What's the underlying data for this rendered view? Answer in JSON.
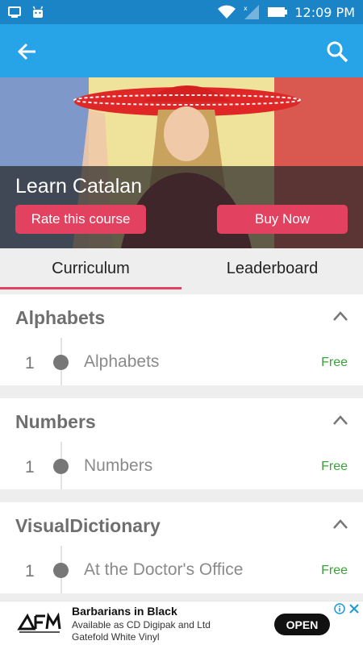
{
  "status_bar": {
    "time": "12:09 PM"
  },
  "app_bar": {
    "back_icon": "arrow-left",
    "search_icon": "search"
  },
  "hero": {
    "title": "Learn Catalan",
    "rate_label": "Rate this course",
    "buy_label": "Buy Now"
  },
  "tabs": [
    {
      "label": "Curriculum",
      "active": true
    },
    {
      "label": "Leaderboard",
      "active": false
    }
  ],
  "sections": [
    {
      "title": "Alphabets",
      "lessons": [
        {
          "num": "1",
          "name": "Alphabets",
          "badge": "Free"
        }
      ]
    },
    {
      "title": "Numbers",
      "lessons": [
        {
          "num": "1",
          "name": "Numbers",
          "badge": "Free"
        }
      ]
    },
    {
      "title": "VisualDictionary",
      "lessons": [
        {
          "num": "1",
          "name": "At the Doctor's Office",
          "badge": "Free"
        }
      ]
    }
  ],
  "ad": {
    "title": "Barbarians in Black",
    "description": "Available as CD Digipak and Ltd Gatefold White Vinyl",
    "cta": "OPEN"
  },
  "colors": {
    "status_bar": "#1a84c7",
    "app_bar": "#27a3e8",
    "accent": "#e2425f",
    "free": "#3aa23a"
  }
}
